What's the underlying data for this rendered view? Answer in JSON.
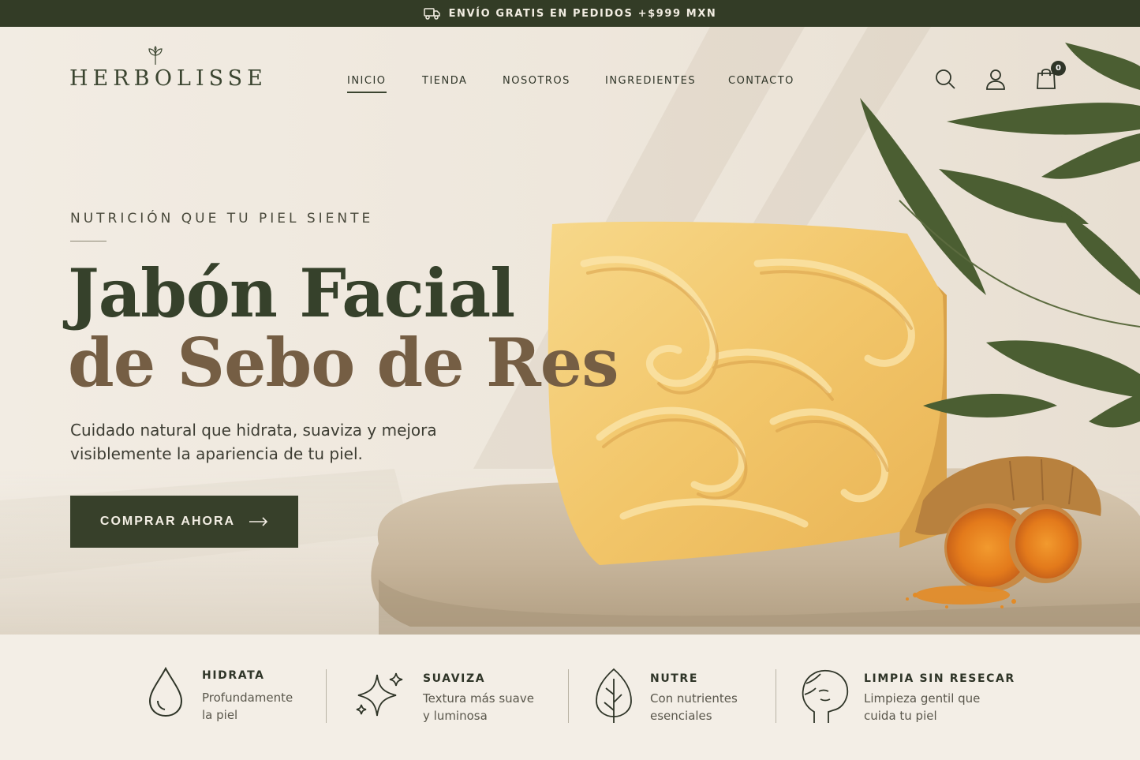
{
  "announcement": {
    "icon": "truck-icon",
    "text": "ENVÍO GRATIS EN PEDIDOS +$999 MXN"
  },
  "brand": {
    "name": "HERBOLISSE",
    "icon": "leaf-logo-icon"
  },
  "nav": {
    "items": [
      {
        "label": "INICIO",
        "active": true
      },
      {
        "label": "TIENDA",
        "active": false
      },
      {
        "label": "NOSOTROS",
        "active": false
      },
      {
        "label": "INGREDIENTES",
        "active": false
      },
      {
        "label": "CONTACTO",
        "active": false
      }
    ]
  },
  "header_icons": {
    "search": "search-icon",
    "account": "user-icon",
    "cart": "shopping-bag-icon",
    "cart_count": "0"
  },
  "hero": {
    "eyebrow": "NUTRICIÓN QUE TU PIEL SIENTE",
    "title_line1": "Jabón Facial",
    "title_line2": "de Sebo de Res",
    "subtitle": "Cuidado natural que hidrata, suaviza y mejora visiblemente la apariencia de tu piel.",
    "cta_label": "COMPRAR AHORA",
    "cta_icon": "arrow-right-icon",
    "image": "soap-bar-on-stone-with-turmeric-and-leaves"
  },
  "features": [
    {
      "icon": "water-drop-icon",
      "title": "HIDRATA",
      "desc": "Profundamente la piel"
    },
    {
      "icon": "sparkle-icon",
      "title": "SUAVIZA",
      "desc": "Textura más suave y luminosa"
    },
    {
      "icon": "leaf-icon",
      "title": "NUTRE",
      "desc": "Con nutrientes esenciales"
    },
    {
      "icon": "face-profile-icon",
      "title": "LIMPIA SIN RESECAR",
      "desc": "Limpieza gentil que cuida tu piel"
    }
  ],
  "colors": {
    "brand_green": "#333c26",
    "brand_brown": "#755e44",
    "background": "#f3ede4",
    "soap_yellow": "#f2c76a"
  }
}
